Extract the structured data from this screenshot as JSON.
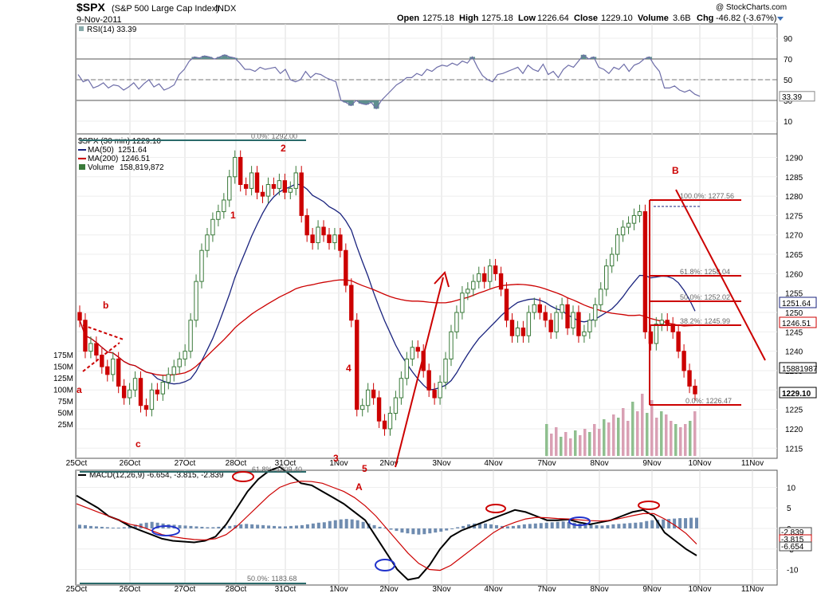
{
  "header": {
    "symbol": "$SPX",
    "name": "(S&P 500 Large Cap Index)",
    "exchange": "INDX",
    "date": "9-Nov-2011",
    "watermark": "@ StockCharts.com",
    "open_label": "Open",
    "open": "1275.18",
    "high_label": "High",
    "high": "1275.18",
    "low_label": "Low",
    "low": "1226.64",
    "close_label": "Close",
    "close": "1229.10",
    "volume_label": "Volume",
    "volume": "3.6B",
    "chg_label": "Chg",
    "chg": "-46.82 (-3.67%)"
  },
  "colors": {
    "price_up": "#3a7a3a",
    "price_down": "#cc0000",
    "ma50": "#1a237e",
    "ma200": "#cc0000",
    "annotation": "#cc0000",
    "rsi_line": "#6d6da8",
    "rsi_fill": "#5f8f8f",
    "macd_line": "#000000",
    "macd_signal": "#cc0000",
    "histogram": "#6f8cb0",
    "volume_up": "#8fbf8f",
    "volume_down": "#d9a0b4",
    "fib_line": "#cc0000"
  },
  "chart_data": [
    {
      "type": "line",
      "panel": "rsi",
      "legend": "RSI(14) 33.39",
      "y_ticks": [
        "90",
        "70",
        "50",
        "30",
        "10"
      ],
      "ylim": [
        0,
        100
      ],
      "levels": [
        70,
        50,
        30
      ],
      "last_value_label": "33.39",
      "series": [
        {
          "name": "RSI(14)",
          "values": [
            55,
            48,
            50,
            42,
            44,
            47,
            42,
            45,
            44,
            40,
            43,
            47,
            41,
            46,
            50,
            43,
            46,
            40,
            42,
            45,
            55,
            60,
            68,
            72,
            71,
            73,
            72,
            70,
            72,
            74,
            72,
            71,
            66,
            60,
            60,
            58,
            62,
            60,
            61,
            62,
            56,
            60,
            50,
            48,
            50,
            58,
            52,
            56,
            55,
            52,
            50,
            48,
            30,
            28,
            25,
            30,
            27,
            26,
            28,
            22,
            30,
            35,
            40,
            45,
            48,
            52,
            52,
            56,
            54,
            60,
            58,
            62,
            64,
            63,
            66,
            64,
            68,
            66,
            72,
            62,
            54,
            50,
            48,
            55,
            56,
            58,
            60,
            62,
            56,
            64,
            60,
            58,
            65,
            55,
            58,
            52,
            60,
            64,
            62,
            68,
            74,
            70,
            72,
            62,
            60,
            56,
            62,
            60,
            65,
            58,
            64,
            66,
            70,
            72,
            64,
            58,
            42,
            42,
            44,
            40,
            38,
            40,
            36,
            34
          ]
        }
      ]
    },
    {
      "type": "candlestick",
      "panel": "price",
      "title": "$SPX (30 min) 1229.10",
      "legend": [
        {
          "name": "MA(50)",
          "value": "1251.64"
        },
        {
          "name": "MA(200)",
          "value": "1246.51"
        },
        {
          "name": "Volume",
          "value": "158,819,872"
        }
      ],
      "ylim": [
        1213,
        1294
      ],
      "y_ticks": [
        "1290",
        "1285",
        "1280",
        "1275",
        "1270",
        "1265",
        "1260",
        "1255",
        "1250",
        "1245",
        "1240",
        "1235",
        "1230",
        "1225",
        "1220",
        "1215"
      ],
      "volume_ticks": [
        "175M",
        "150M",
        "125M",
        "100M",
        "75M",
        "50M",
        "25M"
      ],
      "right_labels": [
        "1251.64",
        "1246.51",
        "158819872",
        "1229.10"
      ],
      "x_labels": [
        "25Oct",
        "26Oct",
        "27Oct",
        "28Oct",
        "31Oct",
        "1Nov",
        "2Nov",
        "3Nov",
        "4Nov",
        "7Nov",
        "8Nov",
        "9Nov",
        "10Nov",
        "11Nov"
      ],
      "close": [
        1248,
        1240,
        1242,
        1239,
        1236,
        1234,
        1238,
        1231,
        1228,
        1230,
        1233,
        1226,
        1225,
        1230,
        1229,
        1232,
        1234,
        1236,
        1238,
        1240,
        1248,
        1258,
        1266,
        1270,
        1274,
        1276,
        1279,
        1285,
        1290,
        1283,
        1282,
        1286,
        1281,
        1280,
        1283,
        1282,
        1284,
        1281,
        1282,
        1286,
        1275,
        1270,
        1268,
        1272,
        1270,
        1268,
        1270,
        1266,
        1257,
        1248,
        1225,
        1226,
        1230,
        1228,
        1222,
        1220,
        1224,
        1228,
        1233,
        1238,
        1241,
        1240,
        1235,
        1230,
        1228,
        1232,
        1238,
        1245,
        1250,
        1255,
        1256,
        1258,
        1260,
        1258,
        1262,
        1260,
        1256,
        1248,
        1244,
        1246,
        1244,
        1250,
        1252,
        1250,
        1248,
        1245,
        1250,
        1252,
        1246,
        1250,
        1244,
        1245,
        1248,
        1252,
        1256,
        1262,
        1265,
        1270,
        1272,
        1273,
        1275,
        1276,
        1245,
        1242,
        1247,
        1248,
        1247,
        1245,
        1240,
        1235,
        1231,
        1229
      ]
    },
    {
      "type": "line",
      "panel": "macd",
      "legend": "MACD(12,26,9) -6.654, -3.815, -2.839",
      "y_ticks": [
        "10",
        "5",
        "0",
        "-5",
        "-10"
      ],
      "ylim": [
        -13,
        13
      ],
      "right_labels": [
        "-2.839",
        "-3.815",
        "-6.654"
      ],
      "series": [
        {
          "name": "MACD",
          "values": [
            8,
            6.5,
            5,
            3,
            2,
            0.5,
            -0.5,
            -1.5,
            -2.5,
            -3,
            -3.2,
            -3.4,
            -3,
            -2,
            1,
            5,
            9,
            12,
            14,
            15,
            13,
            11,
            10.5,
            9,
            7.5,
            6,
            4,
            2,
            -2,
            -6,
            -10,
            -12.5,
            -12,
            -9,
            -5,
            -2,
            -0.5,
            0.5,
            1.5,
            2.5,
            3.5,
            4.5,
            4,
            3,
            2,
            2,
            2.2,
            1.5,
            1,
            1.5,
            2,
            3,
            4,
            4.5,
            3,
            -1,
            -3,
            -5,
            -6.6
          ]
        },
        {
          "name": "Signal",
          "values": [
            6,
            5,
            4,
            3,
            2,
            1,
            0.5,
            -0.5,
            -1.5,
            -2,
            -2.4,
            -2.7,
            -2.8,
            -2.5,
            -1.5,
            0.5,
            3,
            5.5,
            8,
            10,
            11,
            11.5,
            11.4,
            11,
            10,
            9,
            7.5,
            5.5,
            3,
            0,
            -3,
            -6,
            -8.5,
            -10,
            -10.2,
            -9,
            -7,
            -5,
            -3,
            -1,
            0.5,
            1.5,
            2.3,
            2.7,
            2.6,
            2.4,
            2.3,
            2.1,
            1.9,
            1.8,
            2,
            2.5,
            3.1,
            3.6,
            3.6,
            2.3,
            0.7,
            -1.2,
            -3.8
          ]
        }
      ],
      "histogram": [
        0.9,
        0.8,
        0.6,
        0.5,
        0.4,
        0.3,
        0.2,
        0.2,
        0.3,
        0.5,
        0.9,
        1.2,
        1.4,
        1.6,
        1.4,
        1.2,
        1,
        0.9,
        0.8,
        0.7,
        0.6,
        0.5,
        0.4,
        0.3,
        0.3,
        0.4,
        0.5,
        0.6,
        0.8,
        1,
        1.1,
        1.0,
        0.9,
        0.8,
        0.7,
        0.6,
        0.5,
        0.5,
        0.6,
        0.7,
        0.8,
        1.0,
        1.2,
        1.4,
        1.5,
        1.8,
        2.0,
        2.2,
        2.3,
        2.2,
        2.0,
        1.6,
        1.2,
        0.8,
        0.4,
        0.2,
        -0.3,
        -0.6,
        -1.0,
        -1.2,
        -1.4,
        -1.5,
        -1.4,
        -1.2,
        -1.0,
        -0.8,
        -0.5,
        -0.2,
        0.3,
        0.6,
        1.0,
        1.2,
        1.3,
        1.2,
        1.0,
        0.8,
        0.6,
        0.5,
        0.6,
        0.8,
        1.0,
        1.1,
        1.2,
        1.3,
        1.4,
        1.5,
        1.6,
        1.7,
        1.6,
        1.4,
        1.2,
        1.0,
        0.9,
        0.8,
        0.7,
        0.8,
        1.0,
        1.1,
        1.2,
        1.3,
        1.4,
        1.5,
        1.8,
        2.0,
        2.1,
        2.2,
        2.3,
        2.4,
        2.5,
        2.5,
        2.6,
        2.6
      ]
    }
  ],
  "fib_labels": {
    "price_top": "0.0%: 1292.00",
    "macd_top": "61.8%: 1209.40",
    "macd_bottom": "50.0%: 1183.68",
    "b100": "100.0%: 1277.56",
    "b618": "61.8%: 1258.04",
    "b500": "50.0%: 1252.02",
    "b382": "38.2%: 1245.99",
    "b0": "0.0%: 1226.47"
  },
  "annotations": {
    "wave_a_lower": "a",
    "wave_b_lower": "b",
    "wave_c_lower": "c",
    "wave_1": "1",
    "wave_2": "2",
    "wave_3": "3",
    "wave_4": "4",
    "wave_5": "5",
    "wave_A": "A",
    "wave_B": "B"
  }
}
